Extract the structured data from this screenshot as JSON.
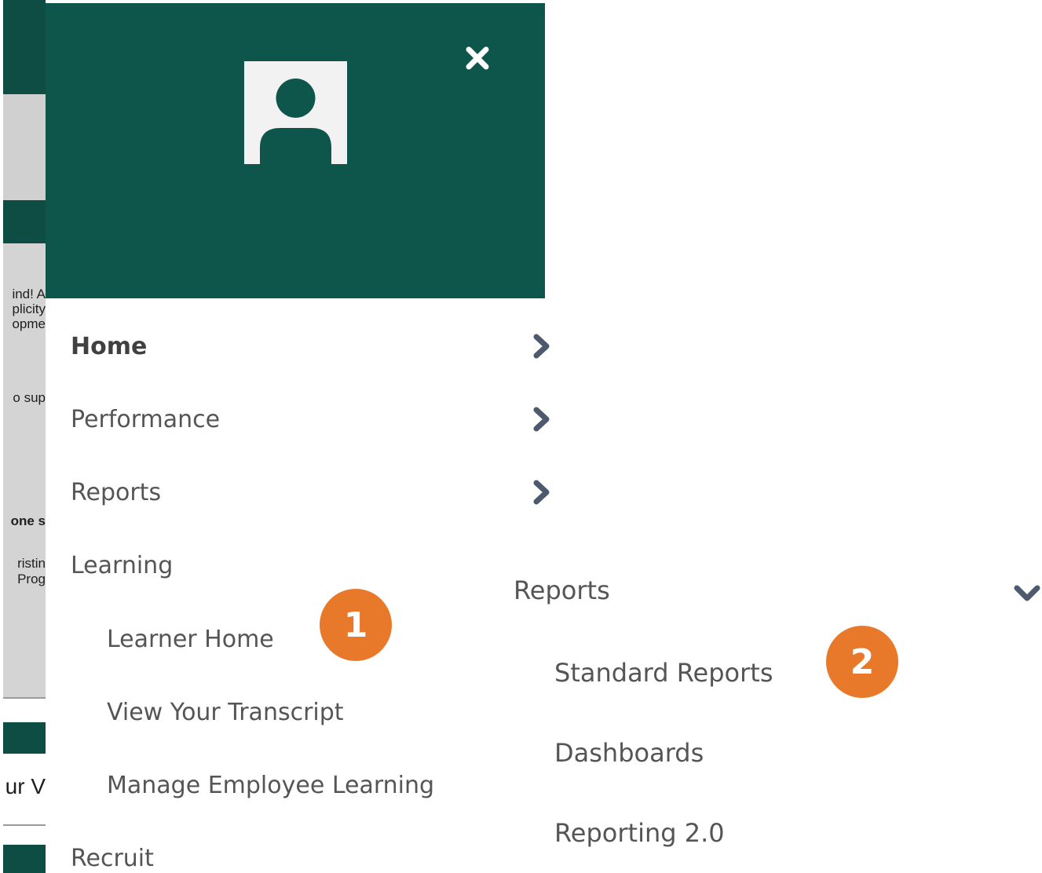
{
  "background": {
    "snippets": [
      "ind! A",
      "plicity",
      "opme",
      "o sup",
      "one s",
      "ristin",
      "Prog",
      "ur V"
    ]
  },
  "panel": {
    "close_icon": "close-icon",
    "avatar_icon": "user-avatar-icon",
    "header_color": "#0e564b"
  },
  "menu": {
    "items": [
      {
        "label": "Home",
        "has_chevron": true
      },
      {
        "label": "Performance",
        "has_chevron": true
      },
      {
        "label": "Reports",
        "has_chevron": true
      },
      {
        "label": "Learning"
      }
    ],
    "learning_children": [
      "Learner Home",
      "View Your Transcript",
      "Manage Employee Learning"
    ],
    "recruit_label": "Recruit"
  },
  "reports_submenu": {
    "title": "Reports",
    "expanded_icon": "chevron-down-icon",
    "items": [
      "Standard Reports",
      "Dashboards",
      "Reporting 2.0"
    ]
  },
  "callouts": {
    "one": "1",
    "two": "2",
    "color": "#e8792b"
  }
}
